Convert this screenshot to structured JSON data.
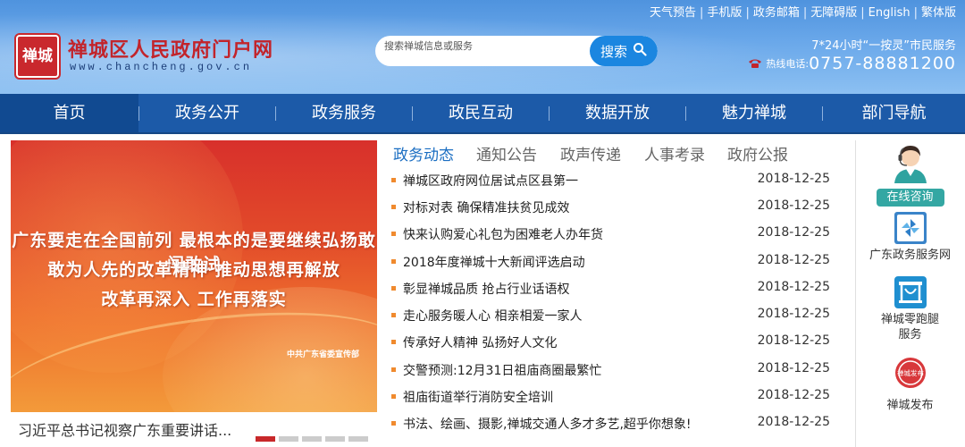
{
  "header": {
    "top_links": [
      "天气预告",
      "手机版",
      "政务邮箱",
      "无障碍版",
      "English",
      "繁体版"
    ],
    "logo_seal_text": "禅城",
    "site_title": "禅城区人民政府门户网",
    "site_url": "www.chancheng.gov.cn",
    "search": {
      "placeholder": "搜索禅城信息或服务",
      "button_label": "搜索"
    },
    "service_text": "7*24小时“一按灵”市民服务",
    "hotline_label": "热线电话:",
    "hotline_number": "0757-88881200"
  },
  "nav": {
    "items": [
      "首页",
      "政务公开",
      "政务服务",
      "政民互动",
      "数据开放",
      "魅力禅城",
      "部门导航"
    ],
    "active_index": 0
  },
  "banner": {
    "line1": "广东要走在全国前列 最根本的是要继续弘扬敢闯敢试",
    "line2": "敢为人先的改革精神 推动思想再解放",
    "line3": "改革再深入 工作再落实",
    "org": "中共广东省委宣传部",
    "caption": "习近平总书记视察广东重要讲话...",
    "slide_count": 5,
    "active_slide": 0
  },
  "news": {
    "tabs": [
      "政务动态",
      "通知公告",
      "政声传递",
      "人事考录",
      "政府公报"
    ],
    "active_tab": 0,
    "items": [
      {
        "title": "禅城区政府网位居试点区县第一",
        "date": "2018-12-25"
      },
      {
        "title": "对标对表 确保精准扶贫见成效",
        "date": "2018-12-25"
      },
      {
        "title": "快来认购爱心礼包为困难老人办年货",
        "date": "2018-12-25"
      },
      {
        "title": "2018年度禅城十大新闻评选启动",
        "date": "2018-12-25"
      },
      {
        "title": "彰显禅城品质 抢占行业话语权",
        "date": "2018-12-25"
      },
      {
        "title": "走心服务暖人心 相亲相爱一家人",
        "date": "2018-12-25"
      },
      {
        "title": "传承好人精神 弘扬好人文化",
        "date": "2018-12-25"
      },
      {
        "title": "交警预测:12月31日祖庙商圈最繁忙",
        "date": "2018-12-25"
      },
      {
        "title": "祖庙街道举行消防安全培训",
        "date": "2018-12-25"
      },
      {
        "title": "书法、绘画、摄影,禅城交通人多才多艺,超乎你想象!",
        "date": "2018-12-25"
      }
    ]
  },
  "sidebar": {
    "consult_label": "在线咨询",
    "gd_service_label": "广东政务服务网",
    "zero_run_label_1": "禅城零跑腿",
    "zero_run_label_2": "服务",
    "release_badge_text": "禅城发布",
    "release_label": "禅城发布"
  },
  "colors": {
    "header_blue": "#4f93de",
    "nav_blue": "#1c5aa8",
    "title_red": "#c2242b",
    "accent_orange": "#f08a2e",
    "tab_active_blue": "#1b6ec2"
  }
}
